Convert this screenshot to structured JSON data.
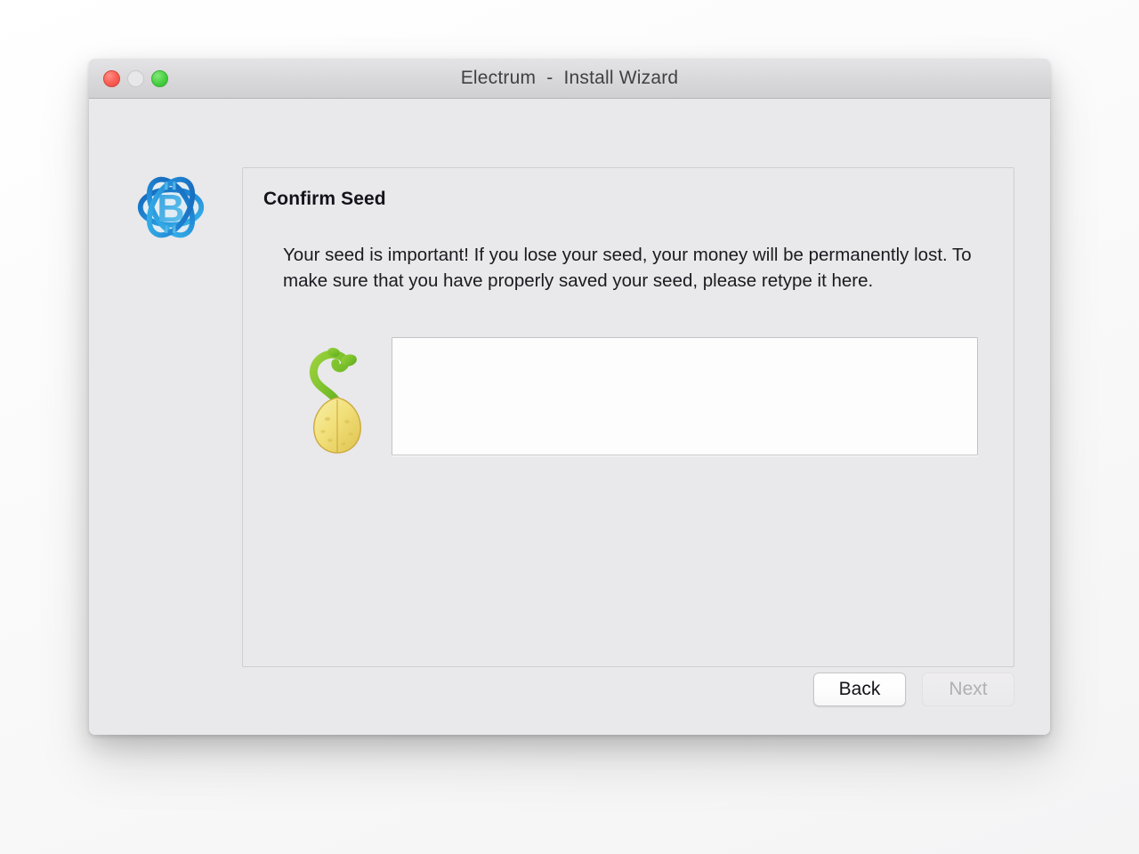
{
  "window": {
    "title": "Electrum  -  Install Wizard",
    "traffic_lights": [
      {
        "name": "close",
        "color": "#fa6258"
      },
      {
        "name": "minimize",
        "color": "#e7e6e8"
      },
      {
        "name": "zoom",
        "color": "#4cd246"
      }
    ]
  },
  "branding": {
    "logo_name": "electrum-logo",
    "logo_color_dark": "#1a6fc4",
    "logo_color_light": "#35b0e8",
    "logo_symbol": "B"
  },
  "panel": {
    "title": "Confirm Seed",
    "description": "Your seed is important! If you lose your seed, your money will be permanently lost. To make sure that you have properly saved your seed, please retype it here.",
    "seed_icon_name": "sprouting-seed-icon",
    "seed_input": {
      "value": "",
      "placeholder": ""
    }
  },
  "footer": {
    "back_label": "Back",
    "next_label": "Next",
    "next_enabled": false
  }
}
